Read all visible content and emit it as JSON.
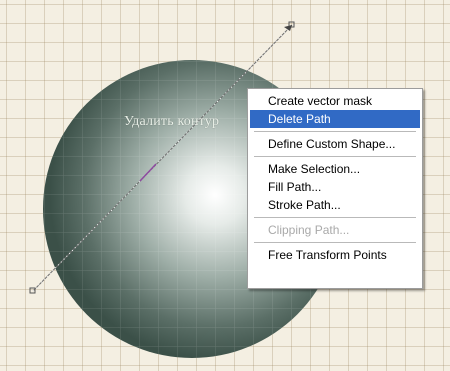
{
  "overlay_label": "Удалить контур",
  "colors": {
    "sphere_dark": "#3b5048",
    "sphere_light": "#ffffff",
    "canvas": "#f4efe2",
    "menu_highlight": "#316ac5"
  },
  "context_menu": {
    "highlighted_item": "Delete Path",
    "groups": [
      [
        {
          "label": "Create vector mask",
          "enabled": true
        },
        {
          "label": "Delete Path",
          "enabled": true
        }
      ],
      [
        {
          "label": "Define Custom Shape...",
          "enabled": true
        }
      ],
      [
        {
          "label": "Make Selection...",
          "enabled": true
        },
        {
          "label": "Fill Path...",
          "enabled": true
        },
        {
          "label": "Stroke Path...",
          "enabled": true
        }
      ],
      [
        {
          "label": "Clipping Path...",
          "enabled": false
        }
      ],
      [
        {
          "label": "Free Transform Points",
          "enabled": true
        }
      ]
    ]
  }
}
